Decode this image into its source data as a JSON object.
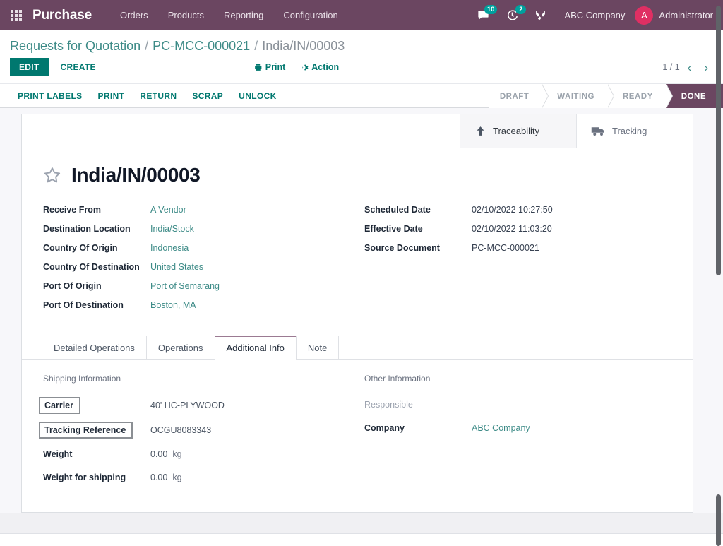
{
  "navbar": {
    "apps_icon": "apps-grid-icon",
    "brand": "Purchase",
    "menu": [
      {
        "label": "Orders"
      },
      {
        "label": "Products"
      },
      {
        "label": "Reporting"
      },
      {
        "label": "Configuration"
      }
    ],
    "messages_icon": "chat-bubble-icon",
    "messages_count": "10",
    "activities_icon": "clock-icon",
    "activities_count": "2",
    "debug_icon": "wrench-icon",
    "company": "ABC Company",
    "avatar_initial": "A",
    "user": "Administrator"
  },
  "control_panel": {
    "breadcrumb": [
      {
        "label": "Requests for Quotation",
        "active": false
      },
      {
        "label": "PC-MCC-000021",
        "active": false
      },
      {
        "label": "India/IN/00003",
        "active": true
      }
    ],
    "separator": "/",
    "edit_label": "EDIT",
    "create_label": "CREATE",
    "print_label": "Print",
    "print_icon": "printer-icon",
    "action_label": "Action",
    "action_icon": "gear-icon",
    "pager_value": "1 / 1",
    "pager_prev_icon": "chevron-left-icon",
    "pager_next_icon": "chevron-right-icon"
  },
  "statusbar": {
    "buttons": [
      {
        "label": "PRINT LABELS"
      },
      {
        "label": "PRINT"
      },
      {
        "label": "RETURN"
      },
      {
        "label": "SCRAP"
      },
      {
        "label": "UNLOCK"
      }
    ],
    "stages": [
      {
        "label": "DRAFT",
        "active": false
      },
      {
        "label": "WAITING",
        "active": false
      },
      {
        "label": "READY",
        "active": false
      },
      {
        "label": "DONE",
        "active": true
      }
    ]
  },
  "smart_buttons": [
    {
      "label": "Traceability",
      "icon": "arrow-up-icon",
      "active": true
    },
    {
      "label": "Tracking",
      "icon": "truck-icon",
      "active": false
    }
  ],
  "record": {
    "star_icon": "star-outline-icon",
    "title": "India/IN/00003",
    "left_fields": [
      {
        "label": "Receive From",
        "value": "A Vendor",
        "link": true
      },
      {
        "label": "Destination Location",
        "value": "India/Stock",
        "link": true
      },
      {
        "label": "Country Of Origin",
        "value": "Indonesia",
        "link": true
      },
      {
        "label": "Country Of Destination",
        "value": "United States",
        "link": true
      },
      {
        "label": "Port Of Origin",
        "value": "Port of Semarang",
        "link": true
      },
      {
        "label": "Port Of Destination",
        "value": "Boston, MA",
        "link": true
      }
    ],
    "right_fields": [
      {
        "label": "Scheduled Date",
        "value": "02/10/2022 10:27:50",
        "link": false
      },
      {
        "label": "Effective Date",
        "value": "02/10/2022 11:03:20",
        "link": false
      },
      {
        "label": "Source Document",
        "value": "PC-MCC-000021",
        "link": false
      }
    ]
  },
  "notebook": {
    "tabs": [
      {
        "label": "Detailed Operations",
        "active": false
      },
      {
        "label": "Operations",
        "active": false
      },
      {
        "label": "Additional Info",
        "active": true
      },
      {
        "label": "Note",
        "active": false
      }
    ],
    "shipping": {
      "group_title": "Shipping Information",
      "fields": [
        {
          "label": "Carrier",
          "value": "40' HC-PLYWOOD",
          "unit": "",
          "highlight": true,
          "link": false,
          "grey": false
        },
        {
          "label": "Tracking Reference",
          "value": "OCGU8083343",
          "unit": "",
          "highlight": true,
          "link": false,
          "grey": false
        },
        {
          "label": "Weight",
          "value": "0.00",
          "unit": "kg",
          "highlight": false,
          "link": false,
          "grey": false
        },
        {
          "label": "Weight for shipping",
          "value": "0.00",
          "unit": "kg",
          "highlight": false,
          "link": false,
          "grey": false
        }
      ]
    },
    "other": {
      "group_title": "Other Information",
      "fields": [
        {
          "label": "Responsible",
          "value": "",
          "unit": "",
          "highlight": false,
          "link": false,
          "grey": true
        },
        {
          "label": "Company",
          "value": "ABC Company",
          "unit": "",
          "highlight": false,
          "link": true,
          "grey": false
        }
      ]
    }
  },
  "colors": {
    "navbar_bg": "#6b4661",
    "accent_teal": "#00786f",
    "link_teal": "#3d8b87",
    "badge": "#00a09d",
    "avatar": "#e02f63",
    "active_tab_border": "#9b7a92"
  }
}
